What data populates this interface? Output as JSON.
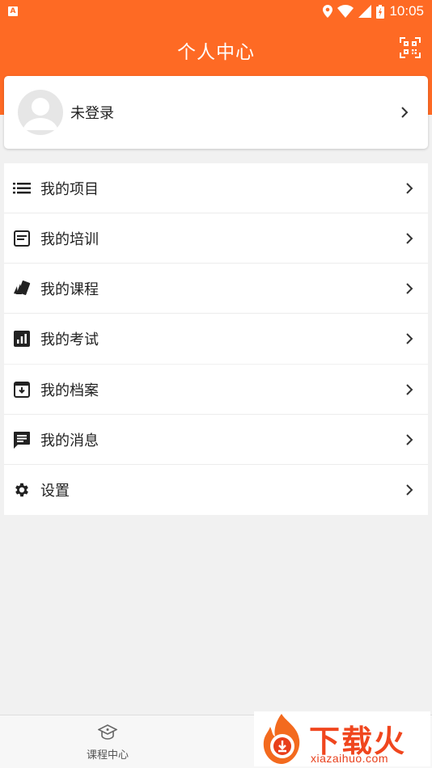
{
  "status_bar": {
    "time": "10:05",
    "left_badge": "A"
  },
  "header": {
    "title": "个人中心",
    "right_icon": "qr-scan-icon"
  },
  "profile": {
    "name": "未登录",
    "avatar_icon": "default-avatar-icon"
  },
  "menu_group_1": [
    {
      "label": "我的项目",
      "icon": "list-icon"
    },
    {
      "label": "我的培训",
      "icon": "training-icon"
    },
    {
      "label": "我的课程",
      "icon": "cards-icon"
    },
    {
      "label": "我的考试",
      "icon": "chart-icon"
    }
  ],
  "menu_group_2": [
    {
      "label": "我的档案",
      "icon": "archive-icon"
    },
    {
      "label": "我的消息",
      "icon": "message-icon"
    },
    {
      "label": "设置",
      "icon": "gear-icon"
    }
  ],
  "bottom_nav": [
    {
      "label": "课程中心",
      "icon": "graduation-cap-icon"
    }
  ],
  "watermark": {
    "title": "下载火",
    "subtitle": "xiazaihuo.com"
  },
  "colors": {
    "accent": "#fe6a24",
    "background": "#f1f1f1",
    "text": "#222222"
  }
}
